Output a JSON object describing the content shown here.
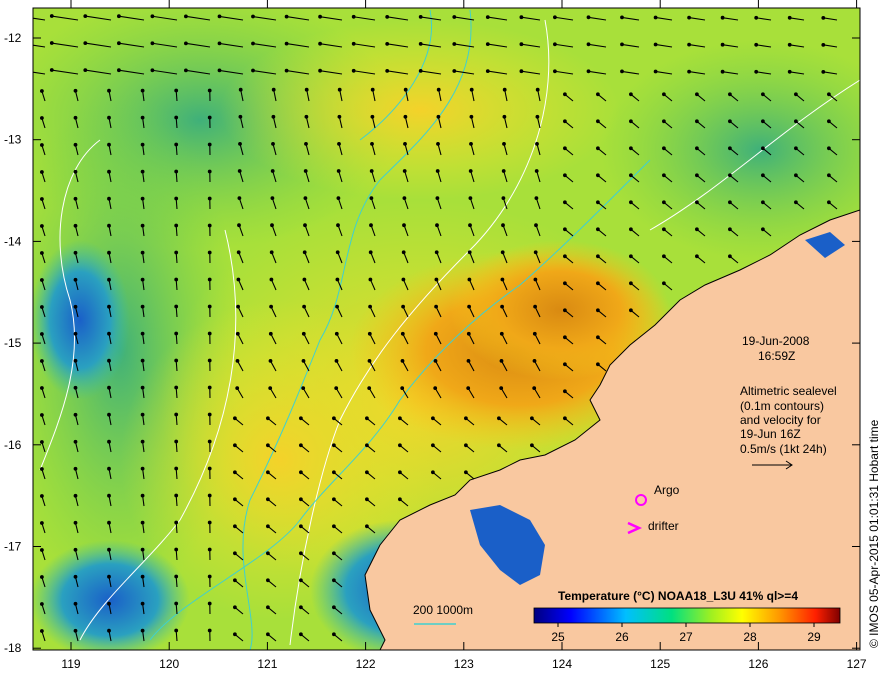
{
  "map": {
    "date": "19-Jun-2008",
    "time": "16:59Z",
    "altimetry_lines": [
      "Altimetric sealevel",
      "(0.1m contours)",
      "and velocity for",
      "19-Jun 16Z"
    ],
    "velocity_scale": "0.5m/s (1kt 24h)",
    "argo_label": "Argo",
    "drifter_label": "drifter",
    "depth_contours_label": "200  1000m",
    "colorbar_title": "Temperature (°C) NOAA18_L3U 41% ql>=4",
    "colorbar_ticks": [
      "25",
      "26",
      "27",
      "28",
      "29"
    ],
    "credit": "© IMOS 05-Apr-2015 01:01:31 Hobart time",
    "lat_ticks": [
      "-12",
      "-13",
      "-14",
      "-15",
      "-16",
      "-17",
      "-18"
    ],
    "lon_ticks": [
      "119",
      "120",
      "121",
      "122",
      "123",
      "124",
      "125",
      "126",
      "127"
    ],
    "colors": {
      "land": "#f9c8a0",
      "velocity_arrows": "#000000",
      "sea_level_contours": "#ffffff",
      "depth_contours": "#3fd0d0",
      "markers": "#ff00ff"
    }
  }
}
